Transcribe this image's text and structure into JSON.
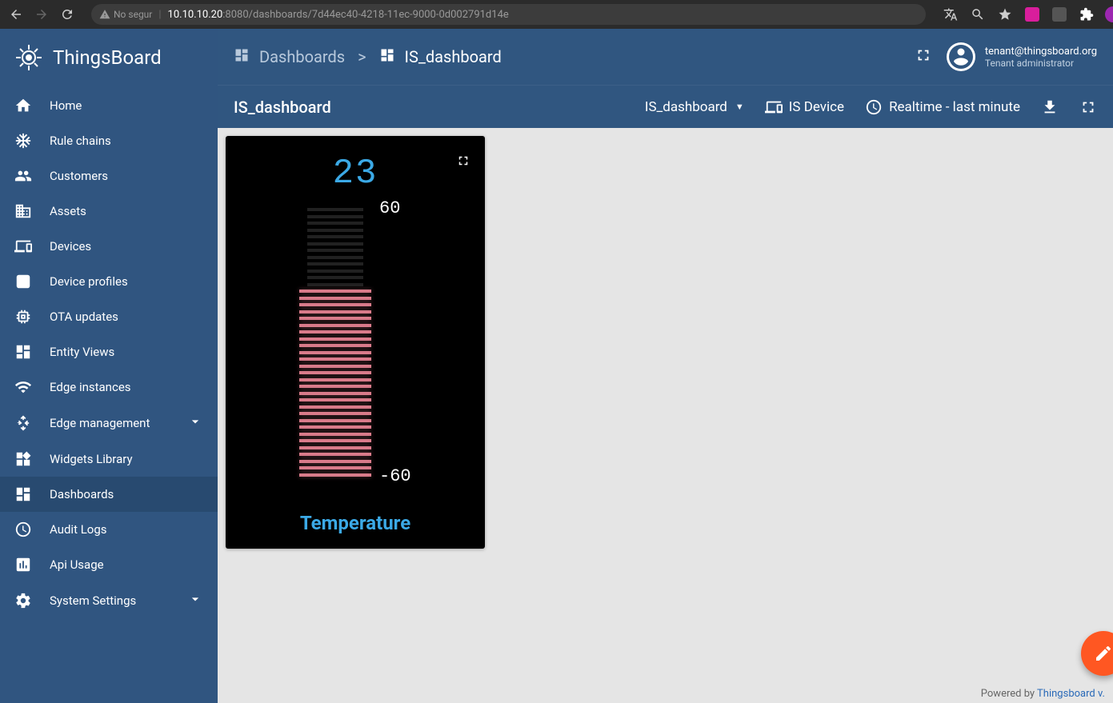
{
  "browser": {
    "security_label": "No segur",
    "url_host": "10.10.10.20",
    "url_port_path": ":8080/dashboards/7d44ec40-4218-11ec-9000-0d002791d14e"
  },
  "logo": {
    "text": "ThingsBoard"
  },
  "sidebar": {
    "items": [
      {
        "label": "Home"
      },
      {
        "label": "Rule chains"
      },
      {
        "label": "Customers"
      },
      {
        "label": "Assets"
      },
      {
        "label": "Devices"
      },
      {
        "label": "Device profiles"
      },
      {
        "label": "OTA updates"
      },
      {
        "label": "Entity Views"
      },
      {
        "label": "Edge instances"
      },
      {
        "label": "Edge management"
      },
      {
        "label": "Widgets Library"
      },
      {
        "label": "Dashboards"
      },
      {
        "label": "Audit Logs"
      },
      {
        "label": "Api Usage"
      },
      {
        "label": "System Settings"
      }
    ]
  },
  "header": {
    "breadcrumb_parent": "Dashboards",
    "breadcrumb_sep": ">",
    "breadcrumb_current": "IS_dashboard",
    "user_email": "tenant@thingsboard.org",
    "user_role": "Tenant administrator"
  },
  "toolbar": {
    "title": "IS_dashboard",
    "state_selector": "IS_dashboard",
    "entity": "IS Device",
    "timewindow": "Realtime - last minute"
  },
  "widget": {
    "value": "23",
    "max_label": "60",
    "min_label": "-60",
    "title": "Temperature"
  },
  "footer": {
    "prefix": "Powered by ",
    "link": "Thingsboard v."
  },
  "chart_data": {
    "type": "bar",
    "title": "Temperature",
    "value": 23,
    "min": -60,
    "max": 60,
    "units": "",
    "segments_total": 40
  }
}
